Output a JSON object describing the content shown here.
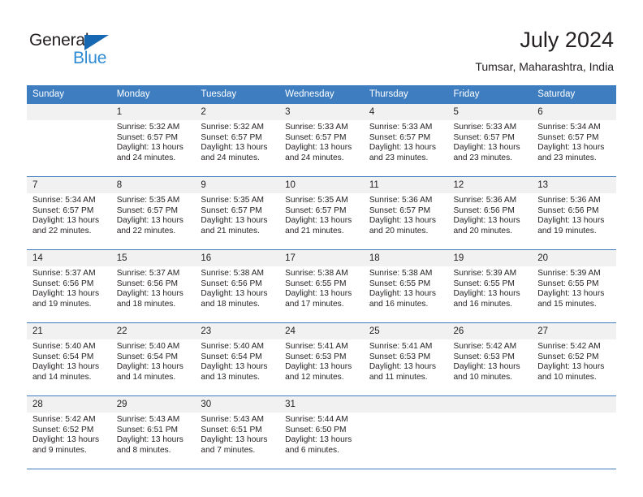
{
  "brand": {
    "name_part1": "General",
    "name_part2": "Blue",
    "triangle_color": "#1668b3",
    "blue_text_color": "#2e8bd4"
  },
  "header": {
    "title": "July 2024",
    "subtitle": "Tumsar, Maharashtra, India"
  },
  "theme": {
    "header_bg": "#3d7dc0",
    "header_text": "#ffffff",
    "daynum_bg": "#f1f1f1",
    "grid_line": "#3d7dc0",
    "body_text": "#231f20"
  },
  "weekday_headers": [
    "Sunday",
    "Monday",
    "Tuesday",
    "Wednesday",
    "Thursday",
    "Friday",
    "Saturday"
  ],
  "weeks": [
    [
      {
        "day": "",
        "sunrise": "",
        "sunset": "",
        "daylight1": "",
        "daylight2": ""
      },
      {
        "day": "1",
        "sunrise": "Sunrise: 5:32 AM",
        "sunset": "Sunset: 6:57 PM",
        "daylight1": "Daylight: 13 hours",
        "daylight2": "and 24 minutes."
      },
      {
        "day": "2",
        "sunrise": "Sunrise: 5:32 AM",
        "sunset": "Sunset: 6:57 PM",
        "daylight1": "Daylight: 13 hours",
        "daylight2": "and 24 minutes."
      },
      {
        "day": "3",
        "sunrise": "Sunrise: 5:33 AM",
        "sunset": "Sunset: 6:57 PM",
        "daylight1": "Daylight: 13 hours",
        "daylight2": "and 24 minutes."
      },
      {
        "day": "4",
        "sunrise": "Sunrise: 5:33 AM",
        "sunset": "Sunset: 6:57 PM",
        "daylight1": "Daylight: 13 hours",
        "daylight2": "and 23 minutes."
      },
      {
        "day": "5",
        "sunrise": "Sunrise: 5:33 AM",
        "sunset": "Sunset: 6:57 PM",
        "daylight1": "Daylight: 13 hours",
        "daylight2": "and 23 minutes."
      },
      {
        "day": "6",
        "sunrise": "Sunrise: 5:34 AM",
        "sunset": "Sunset: 6:57 PM",
        "daylight1": "Daylight: 13 hours",
        "daylight2": "and 23 minutes."
      }
    ],
    [
      {
        "day": "7",
        "sunrise": "Sunrise: 5:34 AM",
        "sunset": "Sunset: 6:57 PM",
        "daylight1": "Daylight: 13 hours",
        "daylight2": "and 22 minutes."
      },
      {
        "day": "8",
        "sunrise": "Sunrise: 5:35 AM",
        "sunset": "Sunset: 6:57 PM",
        "daylight1": "Daylight: 13 hours",
        "daylight2": "and 22 minutes."
      },
      {
        "day": "9",
        "sunrise": "Sunrise: 5:35 AM",
        "sunset": "Sunset: 6:57 PM",
        "daylight1": "Daylight: 13 hours",
        "daylight2": "and 21 minutes."
      },
      {
        "day": "10",
        "sunrise": "Sunrise: 5:35 AM",
        "sunset": "Sunset: 6:57 PM",
        "daylight1": "Daylight: 13 hours",
        "daylight2": "and 21 minutes."
      },
      {
        "day": "11",
        "sunrise": "Sunrise: 5:36 AM",
        "sunset": "Sunset: 6:57 PM",
        "daylight1": "Daylight: 13 hours",
        "daylight2": "and 20 minutes."
      },
      {
        "day": "12",
        "sunrise": "Sunrise: 5:36 AM",
        "sunset": "Sunset: 6:56 PM",
        "daylight1": "Daylight: 13 hours",
        "daylight2": "and 20 minutes."
      },
      {
        "day": "13",
        "sunrise": "Sunrise: 5:36 AM",
        "sunset": "Sunset: 6:56 PM",
        "daylight1": "Daylight: 13 hours",
        "daylight2": "and 19 minutes."
      }
    ],
    [
      {
        "day": "14",
        "sunrise": "Sunrise: 5:37 AM",
        "sunset": "Sunset: 6:56 PM",
        "daylight1": "Daylight: 13 hours",
        "daylight2": "and 19 minutes."
      },
      {
        "day": "15",
        "sunrise": "Sunrise: 5:37 AM",
        "sunset": "Sunset: 6:56 PM",
        "daylight1": "Daylight: 13 hours",
        "daylight2": "and 18 minutes."
      },
      {
        "day": "16",
        "sunrise": "Sunrise: 5:38 AM",
        "sunset": "Sunset: 6:56 PM",
        "daylight1": "Daylight: 13 hours",
        "daylight2": "and 18 minutes."
      },
      {
        "day": "17",
        "sunrise": "Sunrise: 5:38 AM",
        "sunset": "Sunset: 6:55 PM",
        "daylight1": "Daylight: 13 hours",
        "daylight2": "and 17 minutes."
      },
      {
        "day": "18",
        "sunrise": "Sunrise: 5:38 AM",
        "sunset": "Sunset: 6:55 PM",
        "daylight1": "Daylight: 13 hours",
        "daylight2": "and 16 minutes."
      },
      {
        "day": "19",
        "sunrise": "Sunrise: 5:39 AM",
        "sunset": "Sunset: 6:55 PM",
        "daylight1": "Daylight: 13 hours",
        "daylight2": "and 16 minutes."
      },
      {
        "day": "20",
        "sunrise": "Sunrise: 5:39 AM",
        "sunset": "Sunset: 6:55 PM",
        "daylight1": "Daylight: 13 hours",
        "daylight2": "and 15 minutes."
      }
    ],
    [
      {
        "day": "21",
        "sunrise": "Sunrise: 5:40 AM",
        "sunset": "Sunset: 6:54 PM",
        "daylight1": "Daylight: 13 hours",
        "daylight2": "and 14 minutes."
      },
      {
        "day": "22",
        "sunrise": "Sunrise: 5:40 AM",
        "sunset": "Sunset: 6:54 PM",
        "daylight1": "Daylight: 13 hours",
        "daylight2": "and 14 minutes."
      },
      {
        "day": "23",
        "sunrise": "Sunrise: 5:40 AM",
        "sunset": "Sunset: 6:54 PM",
        "daylight1": "Daylight: 13 hours",
        "daylight2": "and 13 minutes."
      },
      {
        "day": "24",
        "sunrise": "Sunrise: 5:41 AM",
        "sunset": "Sunset: 6:53 PM",
        "daylight1": "Daylight: 13 hours",
        "daylight2": "and 12 minutes."
      },
      {
        "day": "25",
        "sunrise": "Sunrise: 5:41 AM",
        "sunset": "Sunset: 6:53 PM",
        "daylight1": "Daylight: 13 hours",
        "daylight2": "and 11 minutes."
      },
      {
        "day": "26",
        "sunrise": "Sunrise: 5:42 AM",
        "sunset": "Sunset: 6:53 PM",
        "daylight1": "Daylight: 13 hours",
        "daylight2": "and 10 minutes."
      },
      {
        "day": "27",
        "sunrise": "Sunrise: 5:42 AM",
        "sunset": "Sunset: 6:52 PM",
        "daylight1": "Daylight: 13 hours",
        "daylight2": "and 10 minutes."
      }
    ],
    [
      {
        "day": "28",
        "sunrise": "Sunrise: 5:42 AM",
        "sunset": "Sunset: 6:52 PM",
        "daylight1": "Daylight: 13 hours",
        "daylight2": "and 9 minutes."
      },
      {
        "day": "29",
        "sunrise": "Sunrise: 5:43 AM",
        "sunset": "Sunset: 6:51 PM",
        "daylight1": "Daylight: 13 hours",
        "daylight2": "and 8 minutes."
      },
      {
        "day": "30",
        "sunrise": "Sunrise: 5:43 AM",
        "sunset": "Sunset: 6:51 PM",
        "daylight1": "Daylight: 13 hours",
        "daylight2": "and 7 minutes."
      },
      {
        "day": "31",
        "sunrise": "Sunrise: 5:44 AM",
        "sunset": "Sunset: 6:50 PM",
        "daylight1": "Daylight: 13 hours",
        "daylight2": "and 6 minutes."
      },
      {
        "day": "",
        "sunrise": "",
        "sunset": "",
        "daylight1": "",
        "daylight2": ""
      },
      {
        "day": "",
        "sunrise": "",
        "sunset": "",
        "daylight1": "",
        "daylight2": ""
      },
      {
        "day": "",
        "sunrise": "",
        "sunset": "",
        "daylight1": "",
        "daylight2": ""
      }
    ]
  ]
}
